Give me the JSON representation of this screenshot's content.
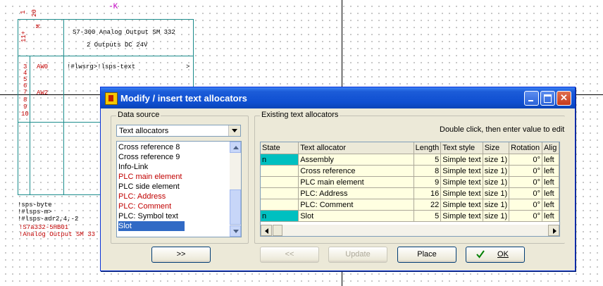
{
  "canvas": {
    "pin_labels": [
      "1",
      "20"
    ],
    "marker_label": "-K",
    "left_pin_label_top": "11+",
    "left_pin_label_top_red": "M",
    "module_title": "S7-300 Analog Output SM 332",
    "module_subtitle": "2 Outputs DC 24V",
    "row_numbers": [
      "3",
      "4",
      "5",
      "6",
      "7",
      "8",
      "9",
      "10"
    ],
    "aw_labels": [
      "AW0",
      "AW2"
    ],
    "text_var": "!#lwsrg>!lsps-text",
    "text_var_end": ">",
    "bottom_lines_dark": [
      "!sps-byte",
      "!#lsps-m>",
      "!#lsps-adr2,4,-2"
    ],
    "bottom_lines_red": [
      "!S7a332-5HB01",
      "!Analog Output SM 33"
    ]
  },
  "dialog": {
    "title": "Modify / insert text allocators",
    "colors": {
      "title_bar": "#0f4fd1",
      "state_highlight": "#00c0c0",
      "red_text": "#c00000",
      "selection": "#316ac5"
    },
    "data_source": {
      "label": "Data source",
      "selected": "Text allocators",
      "items": [
        {
          "label": "Cross reference 8",
          "red": false,
          "selected": false
        },
        {
          "label": "Cross reference 9",
          "red": false,
          "selected": false
        },
        {
          "label": "Info-Link",
          "red": false,
          "selected": false
        },
        {
          "label": "PLC main element",
          "red": true,
          "selected": false
        },
        {
          "label": "PLC side element",
          "red": false,
          "selected": false
        },
        {
          "label": "PLC: Address",
          "red": true,
          "selected": false
        },
        {
          "label": "PLC: Comment",
          "red": true,
          "selected": false
        },
        {
          "label": "PLC: Symbol text",
          "red": false,
          "selected": false
        },
        {
          "label": "Slot",
          "red": false,
          "selected": true
        }
      ]
    },
    "existing": {
      "label": "Existing text allocators",
      "hint": "Double click, then enter value to edit",
      "columns": [
        "State",
        "Text allocator",
        "Length",
        "Text style",
        "Size",
        "Rotation",
        "Alig"
      ],
      "rows": [
        {
          "state": "n",
          "allocator": "Assembly",
          "length": "5",
          "style": "Simple text",
          "size": "size 1)",
          "rotation": "0°",
          "align": "left"
        },
        {
          "state": "",
          "allocator": "Cross reference",
          "length": "8",
          "style": "Simple text",
          "size": "size 1)",
          "rotation": "0°",
          "align": "left"
        },
        {
          "state": "",
          "allocator": "PLC main element",
          "length": "9",
          "style": "Simple text",
          "size": "size 1)",
          "rotation": "0°",
          "align": "left"
        },
        {
          "state": "",
          "allocator": "PLC: Address",
          "length": "16",
          "style": "Simple text",
          "size": "size 1)",
          "rotation": "0°",
          "align": "left"
        },
        {
          "state": "",
          "allocator": "PLC: Comment",
          "length": "22",
          "style": "Simple text",
          "size": "size 1)",
          "rotation": "0°",
          "align": "left"
        },
        {
          "state": "n",
          "allocator": "Slot",
          "length": "5",
          "style": "Simple text",
          "size": "size 1)",
          "rotation": "0°",
          "align": "left"
        }
      ]
    },
    "buttons": {
      "add": ">>",
      "remove": "<<",
      "update": "Update",
      "place": "Place",
      "ok": "OK"
    }
  }
}
